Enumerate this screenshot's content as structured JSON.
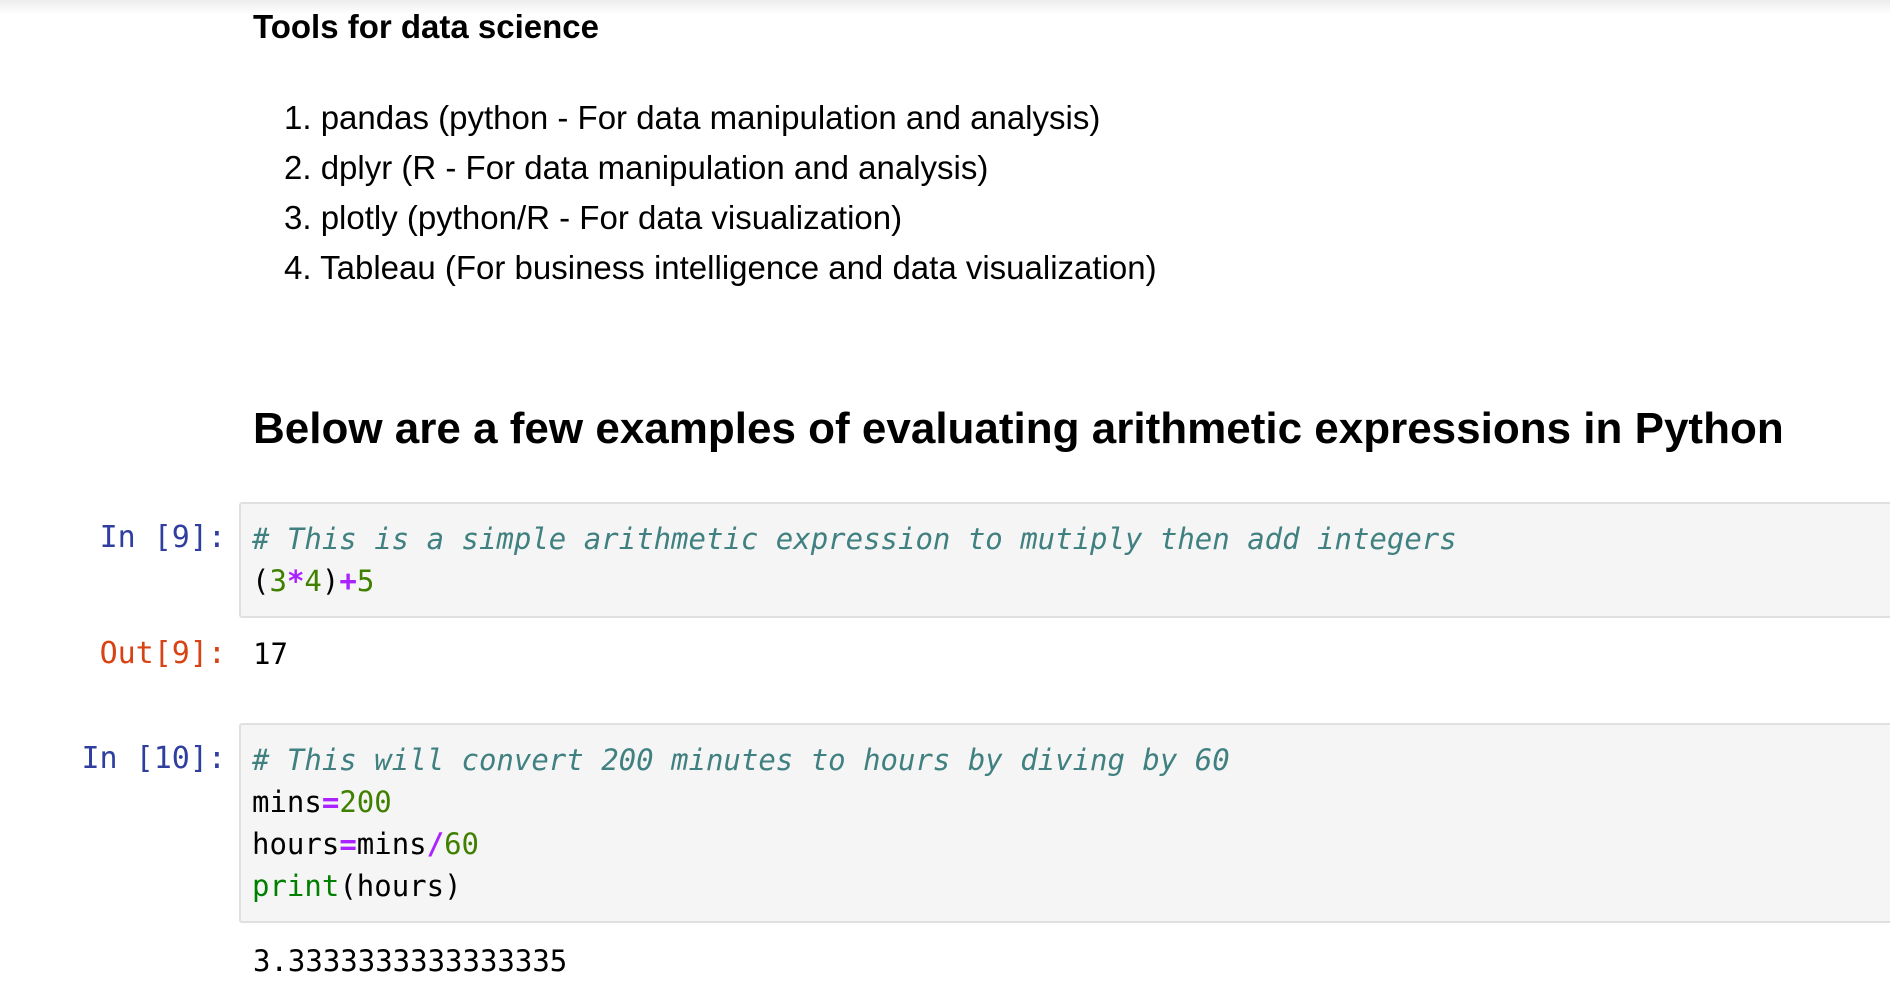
{
  "markdown": {
    "tools_heading": "Tools for data science",
    "tools": [
      "pandas (python - For data manipulation and analysis)",
      "dplyr (R - For data manipulation and analysis)",
      "plotly (python/R - For data visualization)",
      "Tableau (For business intelligence and data visualization)"
    ],
    "tool_numbers": [
      "1.",
      "2.",
      "3.",
      "4."
    ],
    "examples_heading": "Below are a few examples of evaluating arithmetic expressions in Python"
  },
  "cells": [
    {
      "in_prompt": "In [9]:",
      "lines": [
        [
          {
            "t": "comment",
            "v": "# This is a simple arithmetic expression to mutiply then add integers"
          }
        ],
        [
          {
            "t": "name",
            "v": "("
          },
          {
            "t": "num",
            "v": "3"
          },
          {
            "t": "op",
            "v": "*"
          },
          {
            "t": "num",
            "v": "4"
          },
          {
            "t": "name",
            "v": ")"
          },
          {
            "t": "op",
            "v": "+"
          },
          {
            "t": "num",
            "v": "5"
          }
        ]
      ],
      "out_prompt": "Out[9]:",
      "output": "17"
    },
    {
      "in_prompt": "In [10]:",
      "lines": [
        [
          {
            "t": "comment",
            "v": "# This will convert 200 minutes to hours by diving by 60"
          }
        ],
        [
          {
            "t": "name",
            "v": "mins"
          },
          {
            "t": "op",
            "v": "="
          },
          {
            "t": "num",
            "v": "200"
          }
        ],
        [
          {
            "t": "name",
            "v": "hours"
          },
          {
            "t": "op",
            "v": "="
          },
          {
            "t": "name",
            "v": "mins"
          },
          {
            "t": "op",
            "v": "/"
          },
          {
            "t": "num",
            "v": "60"
          }
        ],
        [
          {
            "t": "builtin",
            "v": "print"
          },
          {
            "t": "name",
            "v": "(hours)"
          }
        ]
      ],
      "out_prompt": "",
      "output": "3.3333333333333335"
    }
  ],
  "colors": {
    "prompt_in": "#303f9f",
    "prompt_out": "#d84315",
    "input_bg": "#f5f5f5",
    "comment": "#408080",
    "number": "#408000",
    "operator": "#aa22ff"
  }
}
